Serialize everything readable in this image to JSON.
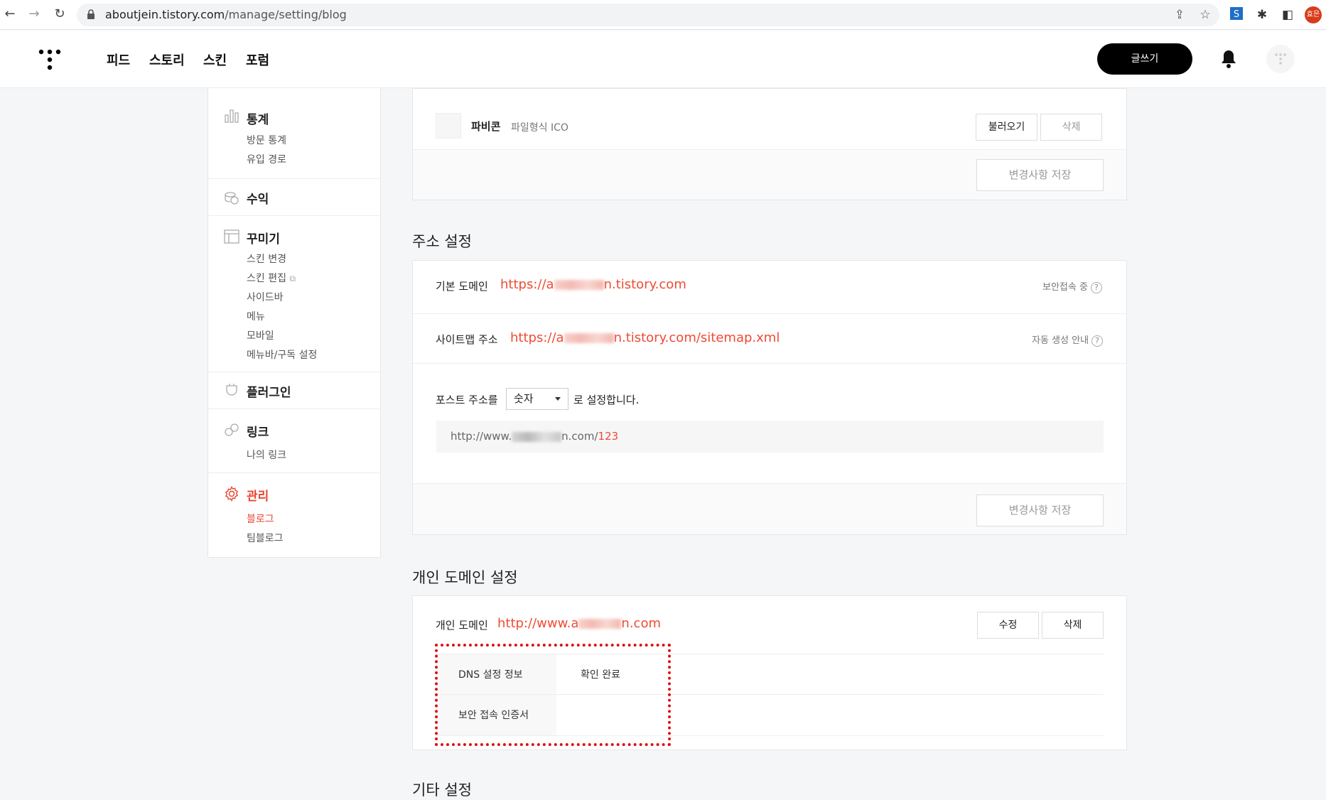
{
  "browser": {
    "url_host": "aboutjein.tistory.com",
    "url_path": "/manage/setting/blog",
    "profile_label": "효은"
  },
  "topnav": {
    "menu": [
      "피드",
      "스토리",
      "스킨",
      "포럼"
    ],
    "write_label": "글쓰기"
  },
  "sidebar": {
    "sections": [
      {
        "title": "통계",
        "items": [
          "방문 통계",
          "유입 경로"
        ]
      },
      {
        "title": "수익",
        "items": []
      },
      {
        "title": "꾸미기",
        "items": [
          "스킨 변경",
          "스킨 편집",
          "사이드바",
          "메뉴",
          "모바일",
          "메뉴바/구독 설정"
        ]
      },
      {
        "title": "플러그인",
        "items": []
      },
      {
        "title": "링크",
        "items": [
          "나의 링크"
        ]
      },
      {
        "title": "관리",
        "items": [
          "블로그",
          "팀블로그"
        ],
        "active": true
      }
    ]
  },
  "favicon": {
    "label": "파비콘",
    "hint": "파일형식 ICO",
    "load_button": "불러오기",
    "delete_button": "삭제",
    "save_button": "변경사항 저장"
  },
  "address": {
    "section_title": "주소 설정",
    "base_domain_label": "기본 도메인",
    "base_domain_prefix": "https://a",
    "base_domain_suffix": "n.tistory.com",
    "secure_note": "보안접속 중",
    "sitemap_label": "사이트맵 주소",
    "sitemap_prefix": "https://a",
    "sitemap_suffix": "n.tistory.com/sitemap.xml",
    "auto_note": "자동 생성 안내",
    "post_addr_label": "포스트 주소를",
    "post_addr_value": "숫자",
    "post_addr_suffix": "로 설정합니다.",
    "example_prefix": "http://www.",
    "example_suffix": "n.com/",
    "example_num": "123",
    "save_button": "변경사항 저장"
  },
  "custom_domain": {
    "section_title": "개인 도메인 설정",
    "label": "개인 도메인",
    "value_prefix": "http://www.a",
    "value_suffix": "n.com",
    "edit_button": "수정",
    "delete_button": "삭제",
    "dns_label": "DNS 설정 정보",
    "dns_value": "확인 완료",
    "ssl_label": "보안 접속 인증서",
    "ssl_value": ""
  },
  "next_section_title": "기타 설정"
}
